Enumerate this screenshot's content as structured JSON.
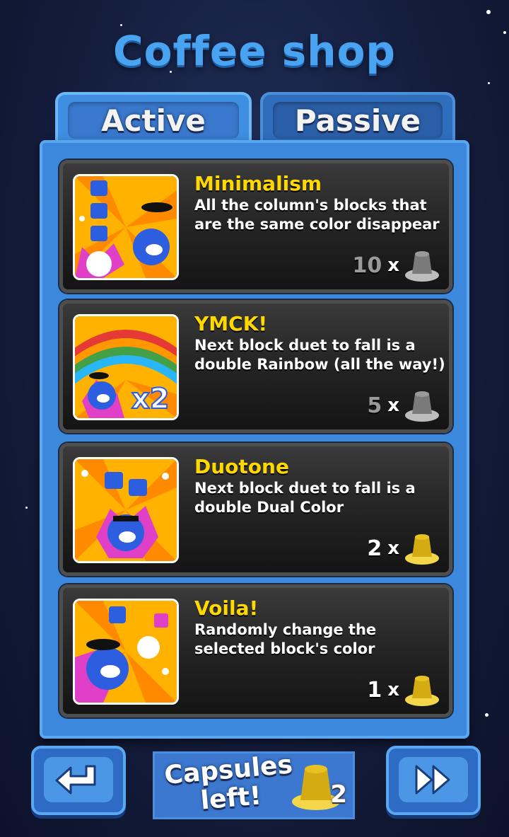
{
  "screen_title": "Coffee shop",
  "tabs": [
    {
      "label": "Active",
      "selected": true
    },
    {
      "label": "Passive",
      "selected": false
    }
  ],
  "items": [
    {
      "name": "Minimalism",
      "description": "All the column's blocks that are the same color disappear",
      "cost": "10",
      "multiplier": "x",
      "capsule_color": "gray"
    },
    {
      "name": "YMCK!",
      "description": "Next block duet to fall is a double Rainbow (all the way!)",
      "cost": "5",
      "multiplier": "x",
      "capsule_color": "gray",
      "image_badge": "x2"
    },
    {
      "name": "Duotone",
      "description": "Next block duet to fall is a double Dual Color",
      "cost": "2",
      "multiplier": "x",
      "capsule_color": "gold"
    },
    {
      "name": "Voila!",
      "description": "Randomly change the selected block's color",
      "cost": "1",
      "multiplier": "x",
      "capsule_color": "gold"
    }
  ],
  "footer": {
    "back_icon": "return-arrow-icon",
    "capsules_label": "Capsules left!",
    "capsules_count": "2",
    "forward_icon": "fast-forward-icon"
  },
  "colors": {
    "title_blue": "#4aa3f0",
    "panel_blue": "#3c88dc",
    "item_title_yellow": "#ffd800",
    "capsule_gold": "#e8c320",
    "capsule_gray": "#8a8a8a"
  }
}
